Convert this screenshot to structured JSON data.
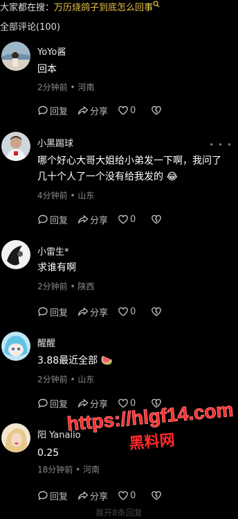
{
  "search": {
    "prefix": "大家都在搜：",
    "term": "万历烧鸽子到底怎么回事",
    "icon": "search-icon"
  },
  "section": {
    "title": "全部评论(100)"
  },
  "actions": {
    "reply": "回复",
    "share": "分享",
    "like_icon": "heart-icon",
    "dislike_icon": "broken-heart-icon",
    "more": "• • •"
  },
  "comments": [
    {
      "user": "YoYo酱",
      "text": "回本",
      "time": "2分钟前",
      "location": "河南",
      "likes": "0"
    },
    {
      "user": "小黑踢球",
      "text": "哪个好心大哥大姐给小弟发一下啊，我问了几十个人了一个没有给我发的",
      "emoji": "😂",
      "time": "4分钟前",
      "location": "山东",
      "likes": "0"
    },
    {
      "user": "小雷生*",
      "text": "求谁有啊",
      "time": "2分钟前",
      "location": "陕西",
      "likes": "0"
    },
    {
      "user": "醒醒",
      "text": "3.88最近全部",
      "emoji": "🍉",
      "time": "2分钟前",
      "location": "山东",
      "likes": "0"
    },
    {
      "user": "阳 Yanaiio",
      "text": "0.25",
      "time": "18分钟前",
      "location": "河南",
      "likes": "0"
    }
  ],
  "watermark": {
    "url": "https://hlgf14.com",
    "cn": "黑料网"
  },
  "footer": {
    "text": "展开8条回复"
  }
}
